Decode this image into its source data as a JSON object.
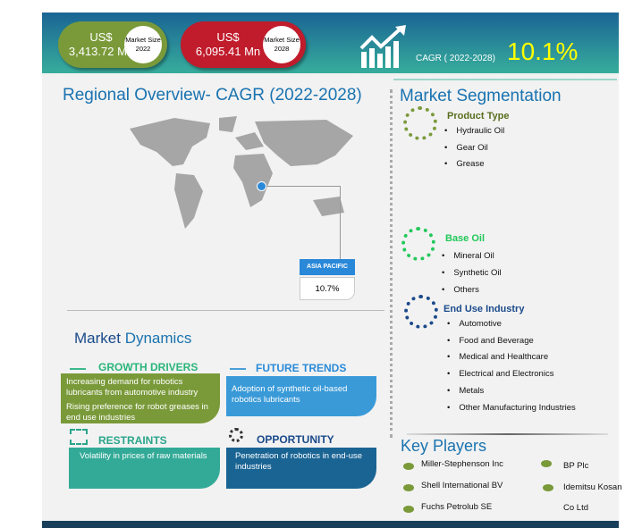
{
  "banner": {
    "size2022": {
      "value_line1": "US$",
      "value_line2": "3,413.72 Mn",
      "label": "Market Size 2022",
      "color": "#7a9a3a"
    },
    "size2028": {
      "value_line1": "US$",
      "value_line2": "6,095.41 Mn",
      "label": "Market Size 2028",
      "color": "#c01c2c"
    },
    "cagr_label": "CAGR ( 2022-2028)",
    "cagr_value": "10.1%"
  },
  "regional": {
    "title_part1": "Regional",
    "title_part2": "Overview- CAGR (2022-2028)",
    "region": "ASIA PACIFIC",
    "region_cagr": "10.7%"
  },
  "dynamics": {
    "title_part1": "Market",
    "title_part2": "Dynamics",
    "growth_drivers": {
      "title": "GROWTH DRIVERS",
      "items": [
        "Increasing demand for robotics lubricants  from automotive industry",
        "Rising preference for robot greases in end use industries"
      ]
    },
    "future_trends": {
      "title": "FUTURE TRENDS",
      "text": "Adoption of synthetic oil-based robotics lubricants"
    },
    "restraints": {
      "title": "RESTRAINTS",
      "items": [
        "Volatility in prices of raw materials"
      ]
    },
    "opportunity": {
      "title": "OPPORTUNITY",
      "items": [
        "Penetration of robotics in end-use industries"
      ]
    }
  },
  "segmentation": {
    "title_part1": "Market",
    "title_part2": "Segmentation",
    "groups": [
      {
        "title": "Product Type",
        "items": [
          "Hydraulic Oil",
          "Gear Oil",
          "Grease"
        ]
      },
      {
        "title": "Base Oil",
        "items": [
          "Mineral Oil",
          "Synthetic Oil",
          "Others"
        ]
      },
      {
        "title": "End Use Industry",
        "items": [
          "Automotive",
          "Food and Beverage",
          "Medical and Healthcare",
          "Electrical and Electronics",
          "Metals",
          "Other Manufacturing Industries"
        ]
      }
    ]
  },
  "key_players": {
    "title": "Key Players",
    "items": [
      "Miller-Stephenson Inc",
      "Shell International BV",
      "Fuchs Petrolub SE",
      "BP Plc",
      "Idemitsu Kosan",
      "Co Ltd"
    ]
  }
}
